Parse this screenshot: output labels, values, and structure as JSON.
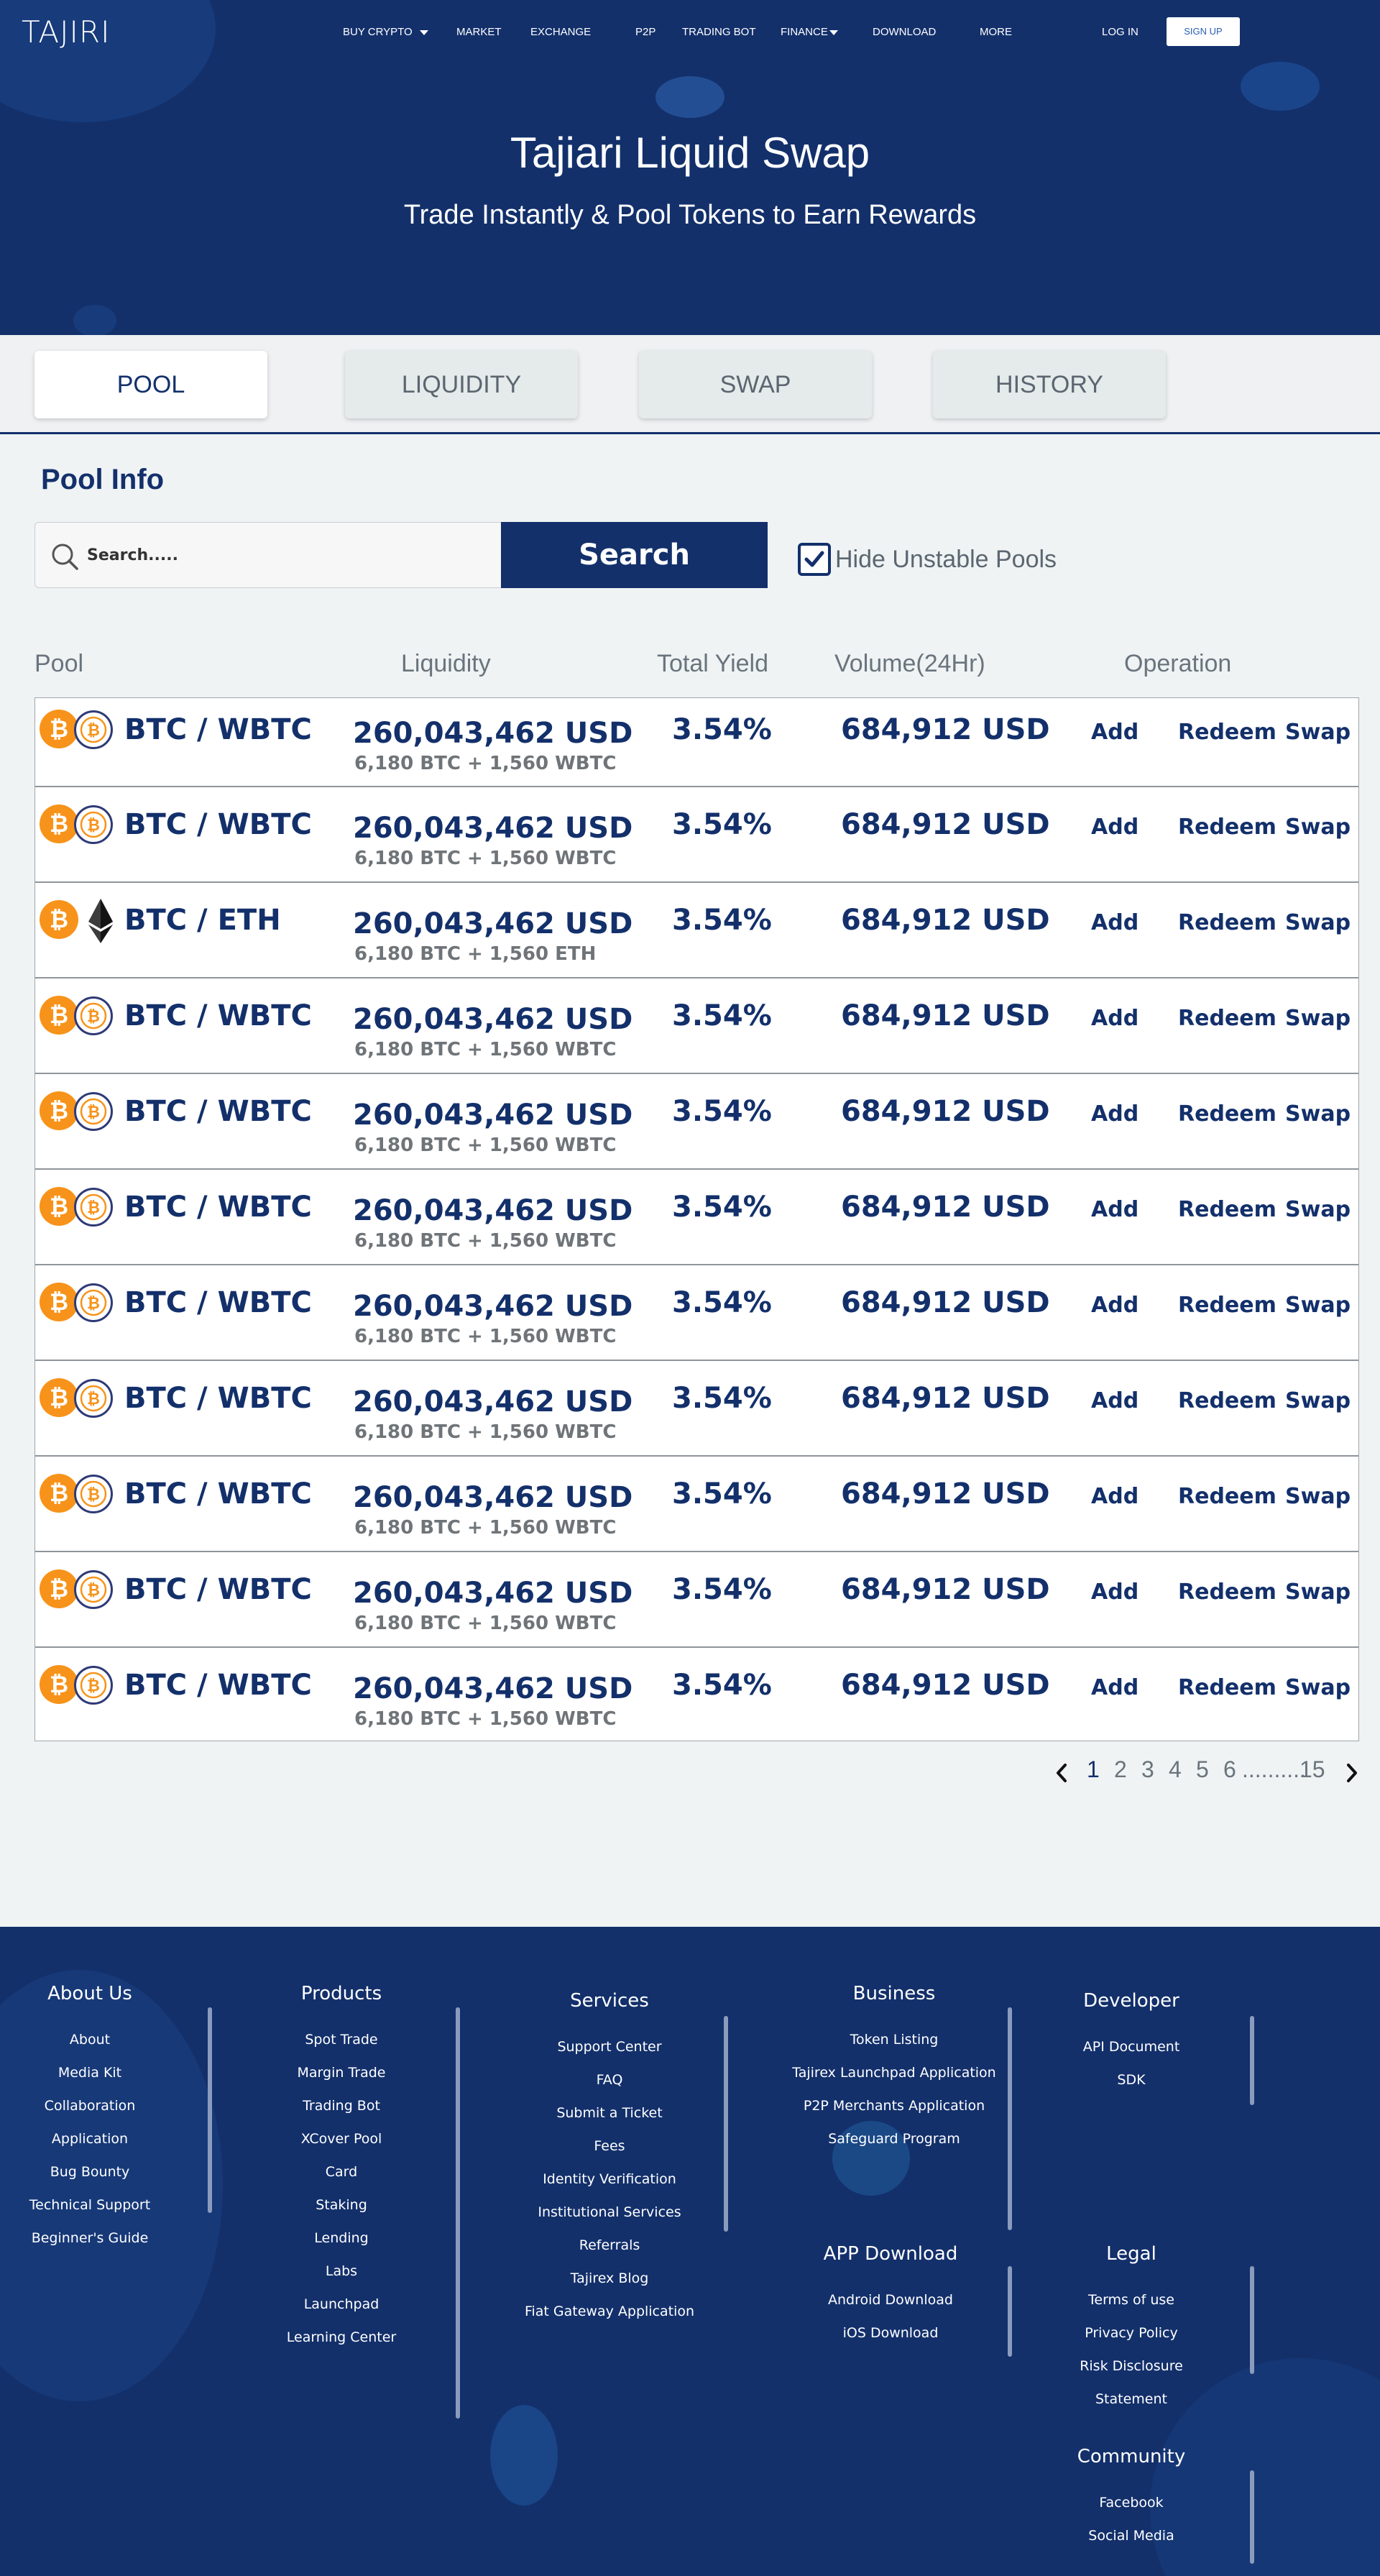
{
  "header": {
    "logo": "TAJIRI",
    "nav": [
      {
        "label": "BUY CRYPTO",
        "caret": true
      },
      {
        "label": "MARKET"
      },
      {
        "label": "EXCHANGE"
      },
      {
        "label": "P2P"
      },
      {
        "label": "TRADING BOT"
      },
      {
        "label": "FINANCE",
        "caret": true
      },
      {
        "label": "DOWNLOAD"
      },
      {
        "label": "MORE"
      }
    ],
    "login": "LOG IN",
    "signup": "SIGN UP",
    "title": "Tajiari Liquid Swap",
    "subtitle": "Trade Instantly & Pool Tokens to Earn Rewards"
  },
  "tabs": [
    {
      "label": "POOL",
      "active": true
    },
    {
      "label": "LIQUIDITY"
    },
    {
      "label": "SWAP"
    },
    {
      "label": "HISTORY"
    }
  ],
  "pool": {
    "title": "Pool Info",
    "search_placeholder": "Search.....",
    "search_button": "Search",
    "hide_unstable_label": "Hide Unstable Pools",
    "hide_unstable_checked": true,
    "columns": [
      "Pool",
      "Liquidity",
      "Total Yield",
      "Volume(24Hr)",
      "Operation"
    ],
    "rows": [
      {
        "pair": "BTC / WBTC",
        "coin2": "wbtc",
        "liquidity": "260,043,462 USD",
        "breakdown": "6,180 BTC + 1,560 WBTC",
        "yield": "3.54%",
        "volume": "684,912 USD"
      },
      {
        "pair": "BTC / WBTC",
        "coin2": "wbtc",
        "liquidity": "260,043,462 USD",
        "breakdown": "6,180 BTC + 1,560 WBTC",
        "yield": "3.54%",
        "volume": "684,912 USD"
      },
      {
        "pair": "BTC / ETH",
        "coin2": "eth",
        "liquidity": "260,043,462 USD",
        "breakdown": "6,180 BTC + 1,560 ETH",
        "yield": "3.54%",
        "volume": "684,912 USD"
      },
      {
        "pair": "BTC / WBTC",
        "coin2": "wbtc",
        "liquidity": "260,043,462 USD",
        "breakdown": "6,180 BTC + 1,560 WBTC",
        "yield": "3.54%",
        "volume": "684,912 USD"
      },
      {
        "pair": "BTC / WBTC",
        "coin2": "wbtc",
        "liquidity": "260,043,462 USD",
        "breakdown": "6,180 BTC + 1,560 WBTC",
        "yield": "3.54%",
        "volume": "684,912 USD"
      },
      {
        "pair": "BTC / WBTC",
        "coin2": "wbtc",
        "liquidity": "260,043,462 USD",
        "breakdown": "6,180 BTC + 1,560 WBTC",
        "yield": "3.54%",
        "volume": "684,912 USD"
      },
      {
        "pair": "BTC / WBTC",
        "coin2": "wbtc",
        "liquidity": "260,043,462 USD",
        "breakdown": "6,180 BTC + 1,560 WBTC",
        "yield": "3.54%",
        "volume": "684,912 USD"
      },
      {
        "pair": "BTC / WBTC",
        "coin2": "wbtc",
        "liquidity": "260,043,462 USD",
        "breakdown": "6,180 BTC + 1,560 WBTC",
        "yield": "3.54%",
        "volume": "684,912 USD"
      },
      {
        "pair": "BTC / WBTC",
        "coin2": "wbtc",
        "liquidity": "260,043,462 USD",
        "breakdown": "6,180 BTC + 1,560 WBTC",
        "yield": "3.54%",
        "volume": "684,912 USD"
      },
      {
        "pair": "BTC / WBTC",
        "coin2": "wbtc",
        "liquidity": "260,043,462 USD",
        "breakdown": "6,180 BTC + 1,560 WBTC",
        "yield": "3.54%",
        "volume": "684,912 USD"
      },
      {
        "pair": "BTC / WBTC",
        "coin2": "wbtc",
        "liquidity": "260,043,462 USD",
        "breakdown": "6,180 BTC + 1,560 WBTC",
        "yield": "3.54%",
        "volume": "684,912 USD"
      }
    ],
    "operations": [
      "Add",
      "Redeem",
      "Swap"
    ]
  },
  "pagination": {
    "pages": [
      "1",
      "2",
      "3",
      "4",
      "5",
      "6"
    ],
    "ellipsis": "..........",
    "last": "15",
    "current": "1"
  },
  "footer": {
    "columns": [
      {
        "title": "About Us",
        "links": [
          "About",
          "Media Kit",
          "Collaboration",
          "Application",
          "Bug Bounty",
          "Technical Support",
          "Beginner's Guide"
        ]
      },
      {
        "title": "Products",
        "links": [
          "Spot Trade",
          "Margin Trade",
          "Trading Bot",
          "XCover Pool",
          "Card",
          "Staking",
          "Lending",
          "Labs",
          "Launchpad",
          "Learning Center"
        ]
      },
      {
        "title": "Services",
        "links": [
          "Support Center",
          "FAQ",
          "Submit a Ticket",
          "Fees",
          "Identity Verification",
          "Institutional Services",
          "Referrals",
          "Tajirex Blog",
          "Fiat Gateway Application"
        ]
      },
      {
        "title": "Business",
        "links": [
          "Token Listing",
          "Tajirex Launchpad Application",
          "P2P Merchants Application",
          "Safeguard Program"
        ]
      },
      {
        "title": "Developer",
        "links": [
          "API Document",
          "SDK"
        ]
      },
      {
        "title": "APP Download",
        "links": [
          "Android Download",
          "iOS Download"
        ]
      },
      {
        "title": "Legal",
        "links": [
          "Terms of use",
          "Privacy Policy",
          "Risk Disclosure",
          "Statement"
        ]
      },
      {
        "title": "Community",
        "links": [
          "Facebook",
          "Social Media"
        ]
      }
    ]
  },
  "colors": {
    "primary": "#13306b",
    "btc": "#f7931a",
    "background": "#eff3f4"
  },
  "icons": [
    "search-icon",
    "check-icon",
    "caret-down-icon",
    "chevron-left-icon",
    "chevron-right-icon",
    "btc-icon",
    "wbtc-icon",
    "eth-icon"
  ]
}
